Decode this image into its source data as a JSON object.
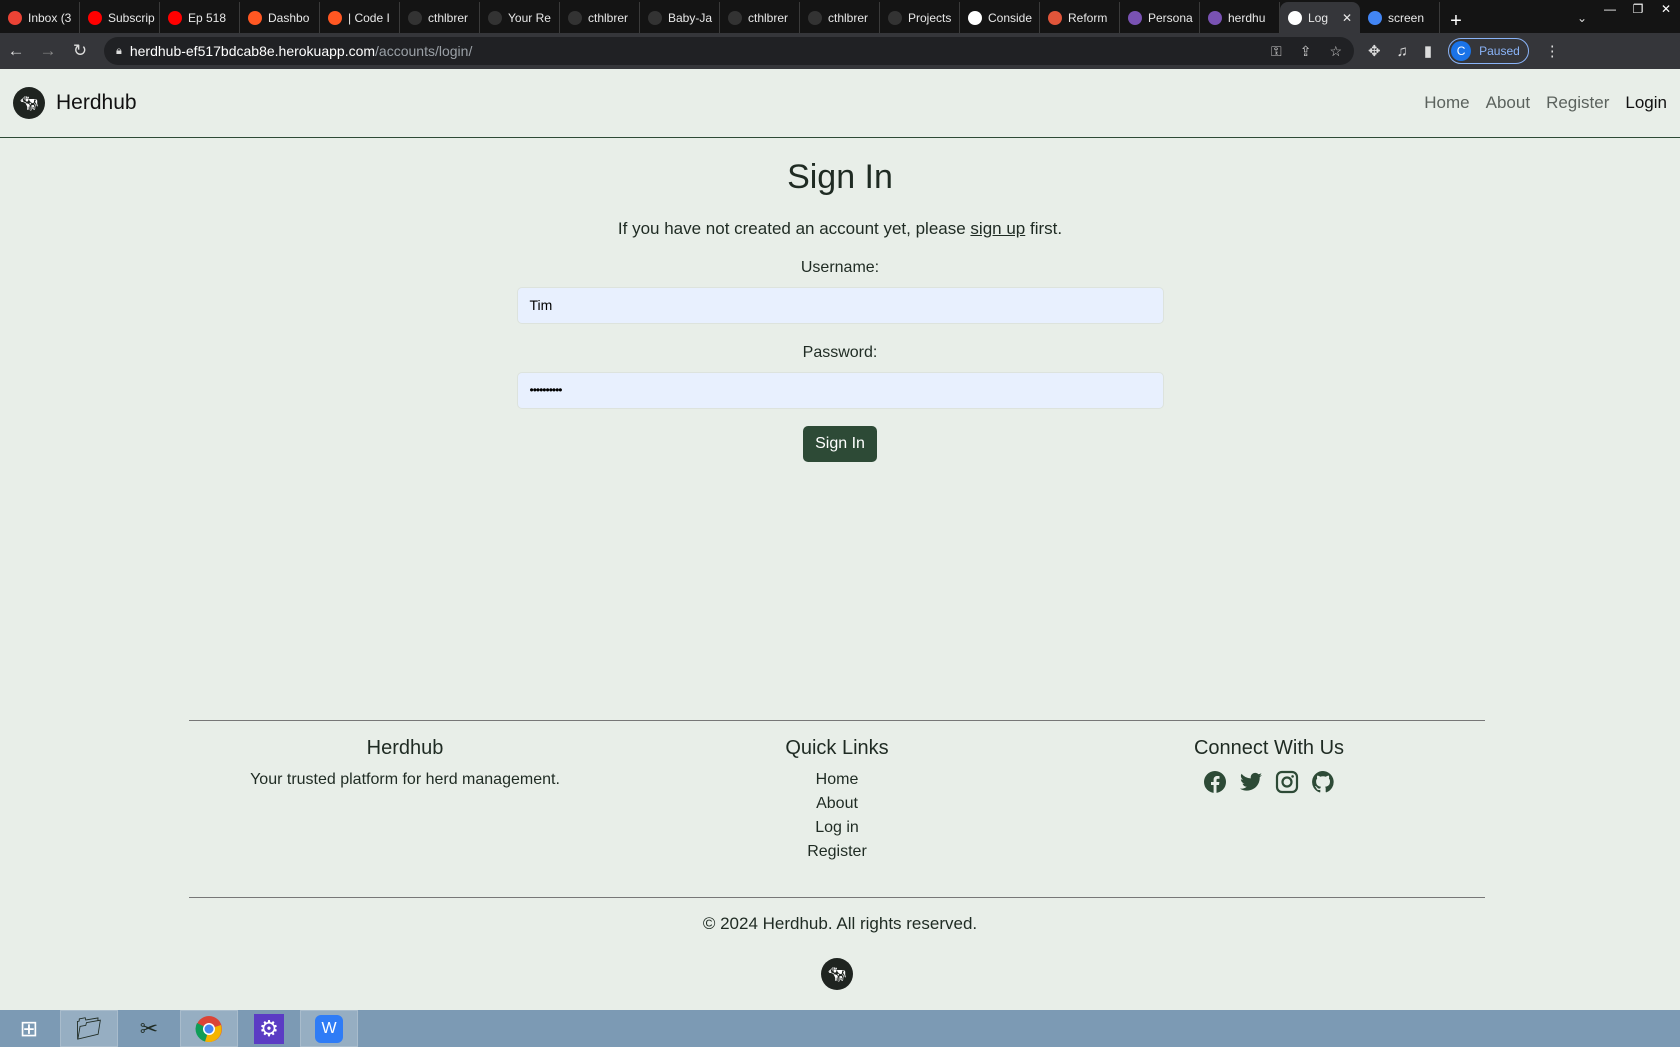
{
  "browser": {
    "tabs": [
      {
        "label": "Inbox (3",
        "color": "#ea4335"
      },
      {
        "label": "Subscrip",
        "color": "#ff0000"
      },
      {
        "label": "Ep 518",
        "color": "#ff0000"
      },
      {
        "label": "Dashbo",
        "color": "#ff5722"
      },
      {
        "label": "| Code I",
        "color": "#ff5722"
      },
      {
        "label": "cthlbrer",
        "color": "#333333"
      },
      {
        "label": "Your Re",
        "color": "#333333"
      },
      {
        "label": "cthlbrer",
        "color": "#333333"
      },
      {
        "label": "Baby-Ja",
        "color": "#333333"
      },
      {
        "label": "cthlbrer",
        "color": "#333333"
      },
      {
        "label": "cthlbrer",
        "color": "#333333"
      },
      {
        "label": "Projects",
        "color": "#333333"
      },
      {
        "label": "Conside",
        "color": "#ffffff"
      },
      {
        "label": "Reform",
        "color": "#e0553a"
      },
      {
        "label": "Persona",
        "color": "#7952b3"
      },
      {
        "label": "herdhu",
        "color": "#7952b3"
      },
      {
        "label": "Log",
        "color": "#ffffff"
      },
      {
        "label": "screen",
        "color": "#4285f4"
      }
    ],
    "active_tab_index": 16,
    "url_host": "herdhub-ef517bdcab8e.herokuapp.com",
    "url_path": "/accounts/login/",
    "profile_initial": "C",
    "profile_status": "Paused"
  },
  "nav": {
    "brand": "Herdhub",
    "links": [
      "Home",
      "About",
      "Register",
      "Login"
    ],
    "active": "Login"
  },
  "main": {
    "title": "Sign In",
    "intro_before": "If you have not created an account yet, please ",
    "intro_link": "sign up",
    "intro_after": " first.",
    "username_label": "Username:",
    "username_value": "Tim",
    "password_label": "Password:",
    "password_value": "••••••••••",
    "submit": "Sign In"
  },
  "footer": {
    "brand_title": "Herdhub",
    "tagline": "Your trusted platform for herd management.",
    "quick_title": "Quick Links",
    "quick_links": [
      "Home",
      "About",
      "Log in",
      "Register"
    ],
    "connect_title": "Connect With Us",
    "social": [
      "facebook-icon",
      "twitter-icon",
      "instagram-icon",
      "github-icon"
    ],
    "copyright": "© 2024 Herdhub. All rights reserved."
  },
  "colors": {
    "accent": "#2d4a36",
    "background": "#e8eee8",
    "input_bg": "#e8f0fe"
  }
}
